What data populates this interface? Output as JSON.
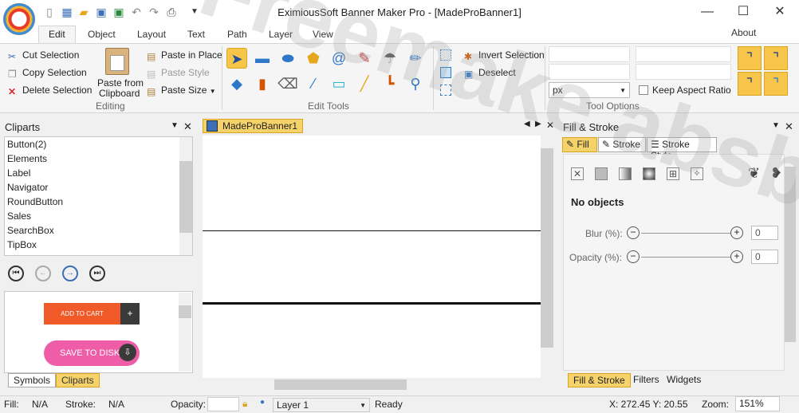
{
  "app": {
    "title": "EximiousSoft Banner Maker Pro - [MadeProBanner1]"
  },
  "window": {
    "minimize": "—",
    "maximize": "☐",
    "close": "✕"
  },
  "menu_tabs": [
    "Edit",
    "Object",
    "Layout",
    "Text",
    "Path",
    "Layer",
    "View"
  ],
  "active_tab": "Edit",
  "about": "About",
  "ribbon": {
    "editing": {
      "cut": "Cut Selection",
      "copy": "Copy Selection",
      "delete": "Delete Selection",
      "paste_from_clipboard_1": "Paste from",
      "paste_from_clipboard_2": "Clipboard",
      "paste_in_place": "Paste in Place",
      "paste_style": "Paste Style",
      "paste_size": "Paste Size",
      "group_label": "Editing"
    },
    "edit_tools": {
      "group_label": "Edit Tools"
    },
    "selection": {
      "invert": "Invert Selection",
      "deselect": "Deselect"
    },
    "tool_options": {
      "unit": "px",
      "keep_aspect": "Keep Aspect Ratio",
      "group_label": "Tool Options"
    }
  },
  "cliparts_panel": {
    "title": "Cliparts",
    "items": [
      "Button(2)",
      "Elements",
      "Label",
      "Navigator",
      "RoundButton",
      "Sales",
      "SearchBox",
      "TipBox"
    ],
    "preview_add_to_cart": "ADD TO CART",
    "preview_plus": "+",
    "preview_save": "SAVE TO DISK",
    "tabs": [
      "Symbols",
      "Cliparts"
    ]
  },
  "document": {
    "tab": "MadeProBanner1"
  },
  "fill_stroke_panel": {
    "title": "Fill & Stroke",
    "tabs": [
      "Fill",
      "Stroke",
      "Stroke Style"
    ],
    "message": "No objects",
    "blur_label": "Blur (%):",
    "blur_value": "0",
    "opacity_label": "Opacity (%):",
    "opacity_value": "0",
    "bottom_tabs": [
      "Fill & Stroke",
      "Filters",
      "Widgets"
    ]
  },
  "status": {
    "fill_label": "Fill:",
    "fill_value": "N/A",
    "stroke_label": "Stroke:",
    "stroke_value": "N/A",
    "opacity_label": "Opacity:",
    "layer": "Layer 1",
    "state": "Ready",
    "coords": "X: 272.45 Y:  20.55",
    "zoom_label": "Zoom:",
    "zoom_value": "151%"
  },
  "watermark": "Freemake absba.org",
  "colors": {
    "accent_orange": "#f6c54a",
    "tab_border": "#d4d4d4",
    "cart_orange": "#f05a28",
    "save_pink": "#ef5da8"
  }
}
